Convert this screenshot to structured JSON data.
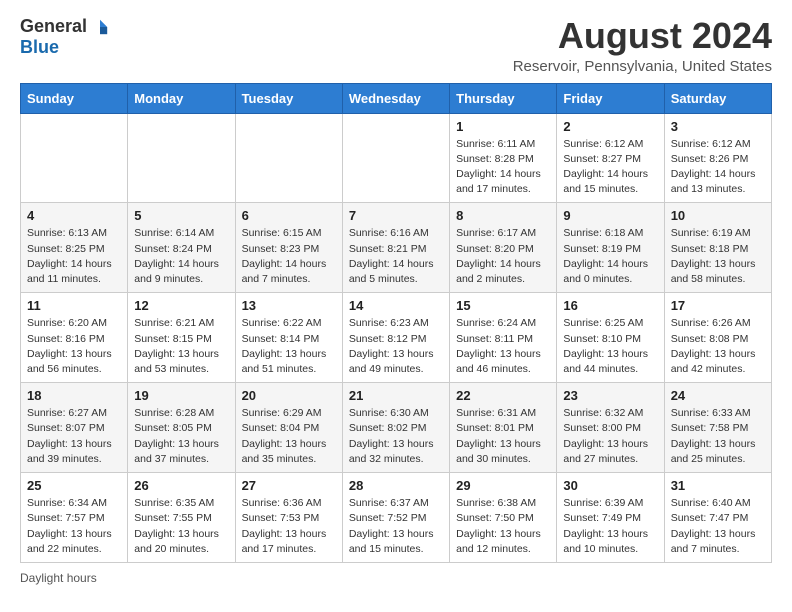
{
  "logo": {
    "general": "General",
    "blue": "Blue"
  },
  "title": "August 2024",
  "location": "Reservoir, Pennsylvania, United States",
  "weekdays": [
    "Sunday",
    "Monday",
    "Tuesday",
    "Wednesday",
    "Thursday",
    "Friday",
    "Saturday"
  ],
  "footer": "Daylight hours",
  "weeks": [
    [
      {
        "day": "",
        "info": ""
      },
      {
        "day": "",
        "info": ""
      },
      {
        "day": "",
        "info": ""
      },
      {
        "day": "",
        "info": ""
      },
      {
        "day": "1",
        "info": "Sunrise: 6:11 AM\nSunset: 8:28 PM\nDaylight: 14 hours and 17 minutes."
      },
      {
        "day": "2",
        "info": "Sunrise: 6:12 AM\nSunset: 8:27 PM\nDaylight: 14 hours and 15 minutes."
      },
      {
        "day": "3",
        "info": "Sunrise: 6:12 AM\nSunset: 8:26 PM\nDaylight: 14 hours and 13 minutes."
      }
    ],
    [
      {
        "day": "4",
        "info": "Sunrise: 6:13 AM\nSunset: 8:25 PM\nDaylight: 14 hours and 11 minutes."
      },
      {
        "day": "5",
        "info": "Sunrise: 6:14 AM\nSunset: 8:24 PM\nDaylight: 14 hours and 9 minutes."
      },
      {
        "day": "6",
        "info": "Sunrise: 6:15 AM\nSunset: 8:23 PM\nDaylight: 14 hours and 7 minutes."
      },
      {
        "day": "7",
        "info": "Sunrise: 6:16 AM\nSunset: 8:21 PM\nDaylight: 14 hours and 5 minutes."
      },
      {
        "day": "8",
        "info": "Sunrise: 6:17 AM\nSunset: 8:20 PM\nDaylight: 14 hours and 2 minutes."
      },
      {
        "day": "9",
        "info": "Sunrise: 6:18 AM\nSunset: 8:19 PM\nDaylight: 14 hours and 0 minutes."
      },
      {
        "day": "10",
        "info": "Sunrise: 6:19 AM\nSunset: 8:18 PM\nDaylight: 13 hours and 58 minutes."
      }
    ],
    [
      {
        "day": "11",
        "info": "Sunrise: 6:20 AM\nSunset: 8:16 PM\nDaylight: 13 hours and 56 minutes."
      },
      {
        "day": "12",
        "info": "Sunrise: 6:21 AM\nSunset: 8:15 PM\nDaylight: 13 hours and 53 minutes."
      },
      {
        "day": "13",
        "info": "Sunrise: 6:22 AM\nSunset: 8:14 PM\nDaylight: 13 hours and 51 minutes."
      },
      {
        "day": "14",
        "info": "Sunrise: 6:23 AM\nSunset: 8:12 PM\nDaylight: 13 hours and 49 minutes."
      },
      {
        "day": "15",
        "info": "Sunrise: 6:24 AM\nSunset: 8:11 PM\nDaylight: 13 hours and 46 minutes."
      },
      {
        "day": "16",
        "info": "Sunrise: 6:25 AM\nSunset: 8:10 PM\nDaylight: 13 hours and 44 minutes."
      },
      {
        "day": "17",
        "info": "Sunrise: 6:26 AM\nSunset: 8:08 PM\nDaylight: 13 hours and 42 minutes."
      }
    ],
    [
      {
        "day": "18",
        "info": "Sunrise: 6:27 AM\nSunset: 8:07 PM\nDaylight: 13 hours and 39 minutes."
      },
      {
        "day": "19",
        "info": "Sunrise: 6:28 AM\nSunset: 8:05 PM\nDaylight: 13 hours and 37 minutes."
      },
      {
        "day": "20",
        "info": "Sunrise: 6:29 AM\nSunset: 8:04 PM\nDaylight: 13 hours and 35 minutes."
      },
      {
        "day": "21",
        "info": "Sunrise: 6:30 AM\nSunset: 8:02 PM\nDaylight: 13 hours and 32 minutes."
      },
      {
        "day": "22",
        "info": "Sunrise: 6:31 AM\nSunset: 8:01 PM\nDaylight: 13 hours and 30 minutes."
      },
      {
        "day": "23",
        "info": "Sunrise: 6:32 AM\nSunset: 8:00 PM\nDaylight: 13 hours and 27 minutes."
      },
      {
        "day": "24",
        "info": "Sunrise: 6:33 AM\nSunset: 7:58 PM\nDaylight: 13 hours and 25 minutes."
      }
    ],
    [
      {
        "day": "25",
        "info": "Sunrise: 6:34 AM\nSunset: 7:57 PM\nDaylight: 13 hours and 22 minutes."
      },
      {
        "day": "26",
        "info": "Sunrise: 6:35 AM\nSunset: 7:55 PM\nDaylight: 13 hours and 20 minutes."
      },
      {
        "day": "27",
        "info": "Sunrise: 6:36 AM\nSunset: 7:53 PM\nDaylight: 13 hours and 17 minutes."
      },
      {
        "day": "28",
        "info": "Sunrise: 6:37 AM\nSunset: 7:52 PM\nDaylight: 13 hours and 15 minutes."
      },
      {
        "day": "29",
        "info": "Sunrise: 6:38 AM\nSunset: 7:50 PM\nDaylight: 13 hours and 12 minutes."
      },
      {
        "day": "30",
        "info": "Sunrise: 6:39 AM\nSunset: 7:49 PM\nDaylight: 13 hours and 10 minutes."
      },
      {
        "day": "31",
        "info": "Sunrise: 6:40 AM\nSunset: 7:47 PM\nDaylight: 13 hours and 7 minutes."
      }
    ]
  ]
}
